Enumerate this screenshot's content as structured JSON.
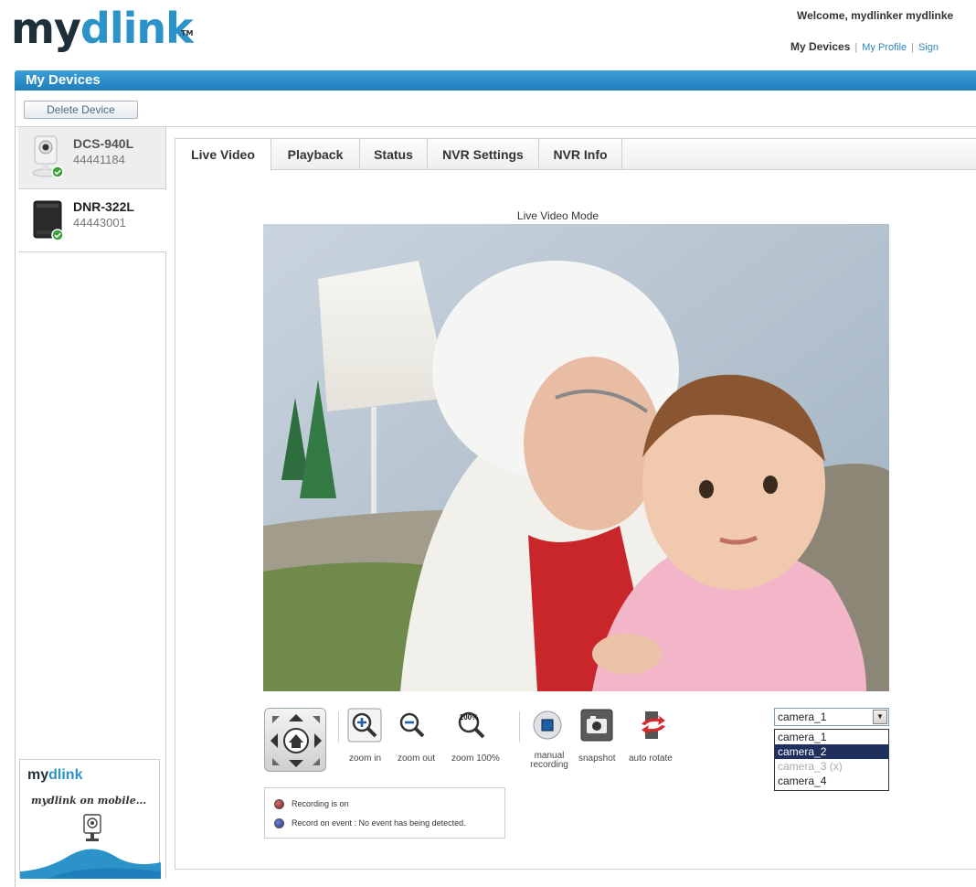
{
  "header": {
    "logo_my": "my",
    "logo_dlink": "dlink",
    "logo_tm": "TM",
    "welcome": "Welcome, mydlinker mydlinke",
    "nav": {
      "my_devices": "My Devices",
      "my_profile": "My Profile",
      "sign": "Sign",
      "separator": "|"
    }
  },
  "page_title": "My Devices",
  "delete_button": "Delete Device",
  "devices": [
    {
      "name": "DCS-940L",
      "id": "44441184",
      "status": "online"
    },
    {
      "name": "DNR-322L",
      "id": "44443001",
      "status": "online"
    }
  ],
  "promo": {
    "logo_my": "my",
    "logo_dlink": "dlink",
    "tagline": "mydlink on mobile..."
  },
  "tabs": [
    "Live Video",
    "Playback",
    "Status",
    "NVR Settings",
    "NVR Info"
  ],
  "active_tab": "Live Video",
  "live_video": {
    "mode_label": "Live Video Mode",
    "controls": {
      "zoom_in": "zoom in",
      "zoom_out": "zoom out",
      "zoom_100": "zoom 100%",
      "zoom_100_badge": "100%",
      "manual_recording": "manual recording",
      "snapshot": "snapshot",
      "auto_rotate": "auto rotate"
    },
    "camera_select": {
      "selected": "camera_1",
      "options": [
        "camera_1",
        "camera_2",
        "camera_3 (x)",
        "camera_4"
      ],
      "highlighted": "camera_2",
      "disabled": "camera_3 (x)"
    },
    "status": {
      "recording": "Recording is on",
      "record_on_event": "Record on event : No event has being detected."
    }
  },
  "colors": {
    "brand_blue": "#2c93c9",
    "bar_blue": "#1f7fbd",
    "logo_dark": "#1f2f3a",
    "select_highlight": "#1f2f5e",
    "recording_dot": "#8b1a1a",
    "event_dot": "#1f3a8b"
  }
}
